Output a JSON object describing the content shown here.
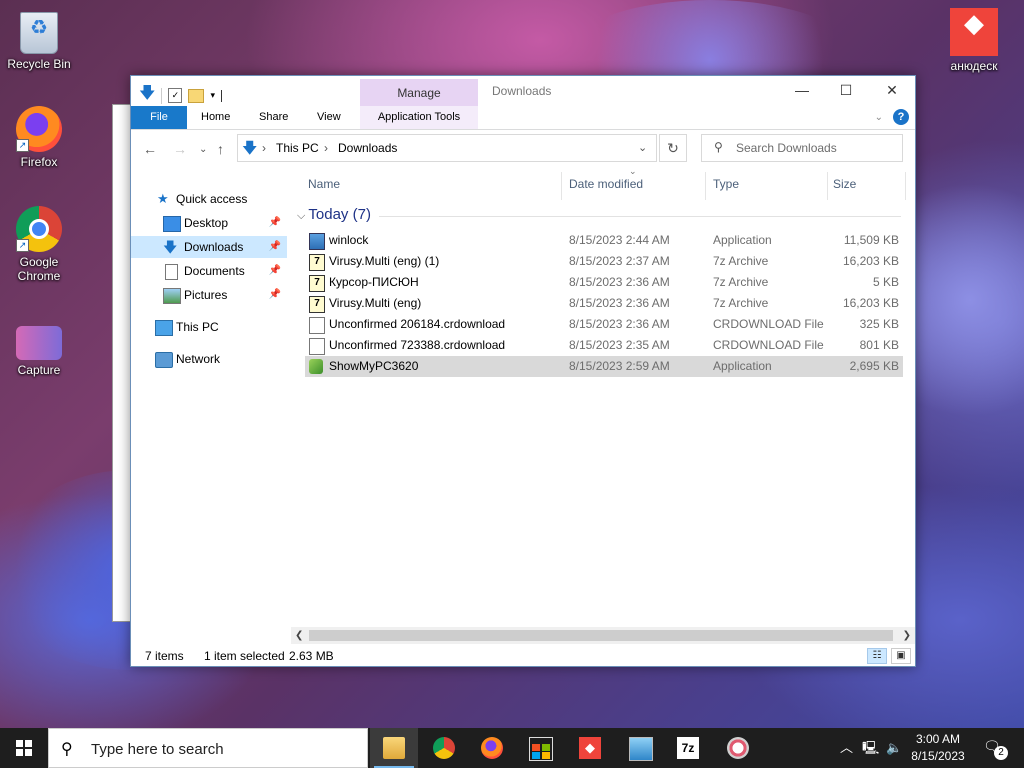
{
  "desktop": {
    "icons": [
      {
        "label": "Recycle Bin"
      },
      {
        "label": "Firefox"
      },
      {
        "label": "Google Chrome"
      },
      {
        "label": "Capture"
      },
      {
        "label": "анюдеск"
      }
    ]
  },
  "window": {
    "title": "Downloads",
    "manage_tab": "Manage",
    "ribbon_tabs": [
      "File",
      "Home",
      "Share",
      "View",
      "Application Tools"
    ],
    "breadcrumb": [
      "This PC",
      "Downloads"
    ],
    "search_placeholder": "Search Downloads",
    "nav": {
      "quick_access": "Quick access",
      "items": [
        "Desktop",
        "Downloads",
        "Documents",
        "Pictures"
      ],
      "this_pc": "This PC",
      "network": "Network"
    },
    "columns": {
      "name": "Name",
      "date": "Date modified",
      "type": "Type",
      "size": "Size"
    },
    "group": "Today (7)",
    "files": [
      {
        "name": "winlock",
        "date": "8/15/2023 2:44 AM",
        "type": "Application",
        "size": "11,509 KB",
        "icon": "app-icon"
      },
      {
        "name": "Virusy.Multi (eng) (1)",
        "date": "8/15/2023 2:37 AM",
        "type": "7z Archive",
        "size": "16,203 KB",
        "icon": "archive-icon"
      },
      {
        "name": "Курсор-ПИСЮН",
        "date": "8/15/2023 2:36 AM",
        "type": "7z Archive",
        "size": "5 KB",
        "icon": "archive-icon"
      },
      {
        "name": "Virusy.Multi (eng)",
        "date": "8/15/2023 2:36 AM",
        "type": "7z Archive",
        "size": "16,203 KB",
        "icon": "archive-icon"
      },
      {
        "name": "Unconfirmed 206184.crdownload",
        "date": "8/15/2023 2:36 AM",
        "type": "CRDOWNLOAD File",
        "size": "325 KB",
        "icon": "document-icon"
      },
      {
        "name": "Unconfirmed 723388.crdownload",
        "date": "8/15/2023 2:35 AM",
        "type": "CRDOWNLOAD File",
        "size": "801 KB",
        "icon": "document-icon"
      },
      {
        "name": "ShowMyPC3620",
        "date": "8/15/2023 2:59 AM",
        "type": "Application",
        "size": "2,695 KB",
        "icon": "showmypc-icon"
      }
    ],
    "status": {
      "items": "7 items",
      "selected": "1 item selected",
      "selected_size": "2.63 MB"
    }
  },
  "taskbar": {
    "search_placeholder": "Type here to search",
    "time": "3:00 AM",
    "date": "8/15/2023",
    "notifications": "2"
  },
  "colors": {
    "accent": "#1979ca",
    "manage": "#e7d4f3",
    "selection": "#cce8ff"
  }
}
